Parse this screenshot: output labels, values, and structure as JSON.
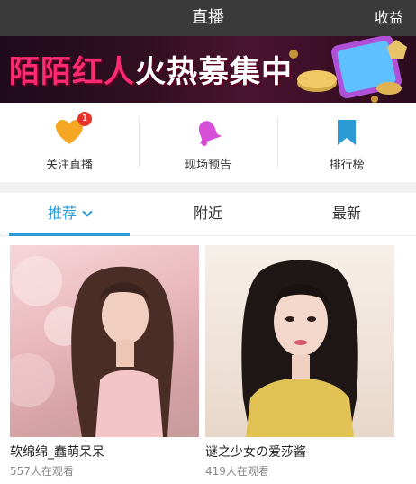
{
  "header": {
    "title": "直播",
    "right_action": "收益"
  },
  "banner": {
    "text_part1": "陌陌红人",
    "text_part2": "火热募集中",
    "slide_count": 3,
    "active_slide": 2
  },
  "quick_actions": [
    {
      "label": "关注直播",
      "icon": "heart-icon",
      "badge": "1"
    },
    {
      "label": "现场预告",
      "icon": "bell-icon"
    },
    {
      "label": "排行榜",
      "icon": "bookmark-icon"
    }
  ],
  "tabs": [
    {
      "label": "推荐",
      "active": true
    },
    {
      "label": "附近",
      "active": false
    },
    {
      "label": "最新",
      "active": false
    }
  ],
  "streams": [
    {
      "title": "软绵绵_蠢萌呆呆",
      "viewers": "557人在观看"
    },
    {
      "title": "谜之少女の爱莎酱",
      "viewers": "419人在观看"
    }
  ],
  "colors": {
    "accent": "#2c9bd5",
    "header_bg": "#3a3a3a",
    "badge": "#e8332c",
    "heart": "#f5a623",
    "bell": "#d54fd9",
    "bookmark": "#2c9bd5"
  }
}
